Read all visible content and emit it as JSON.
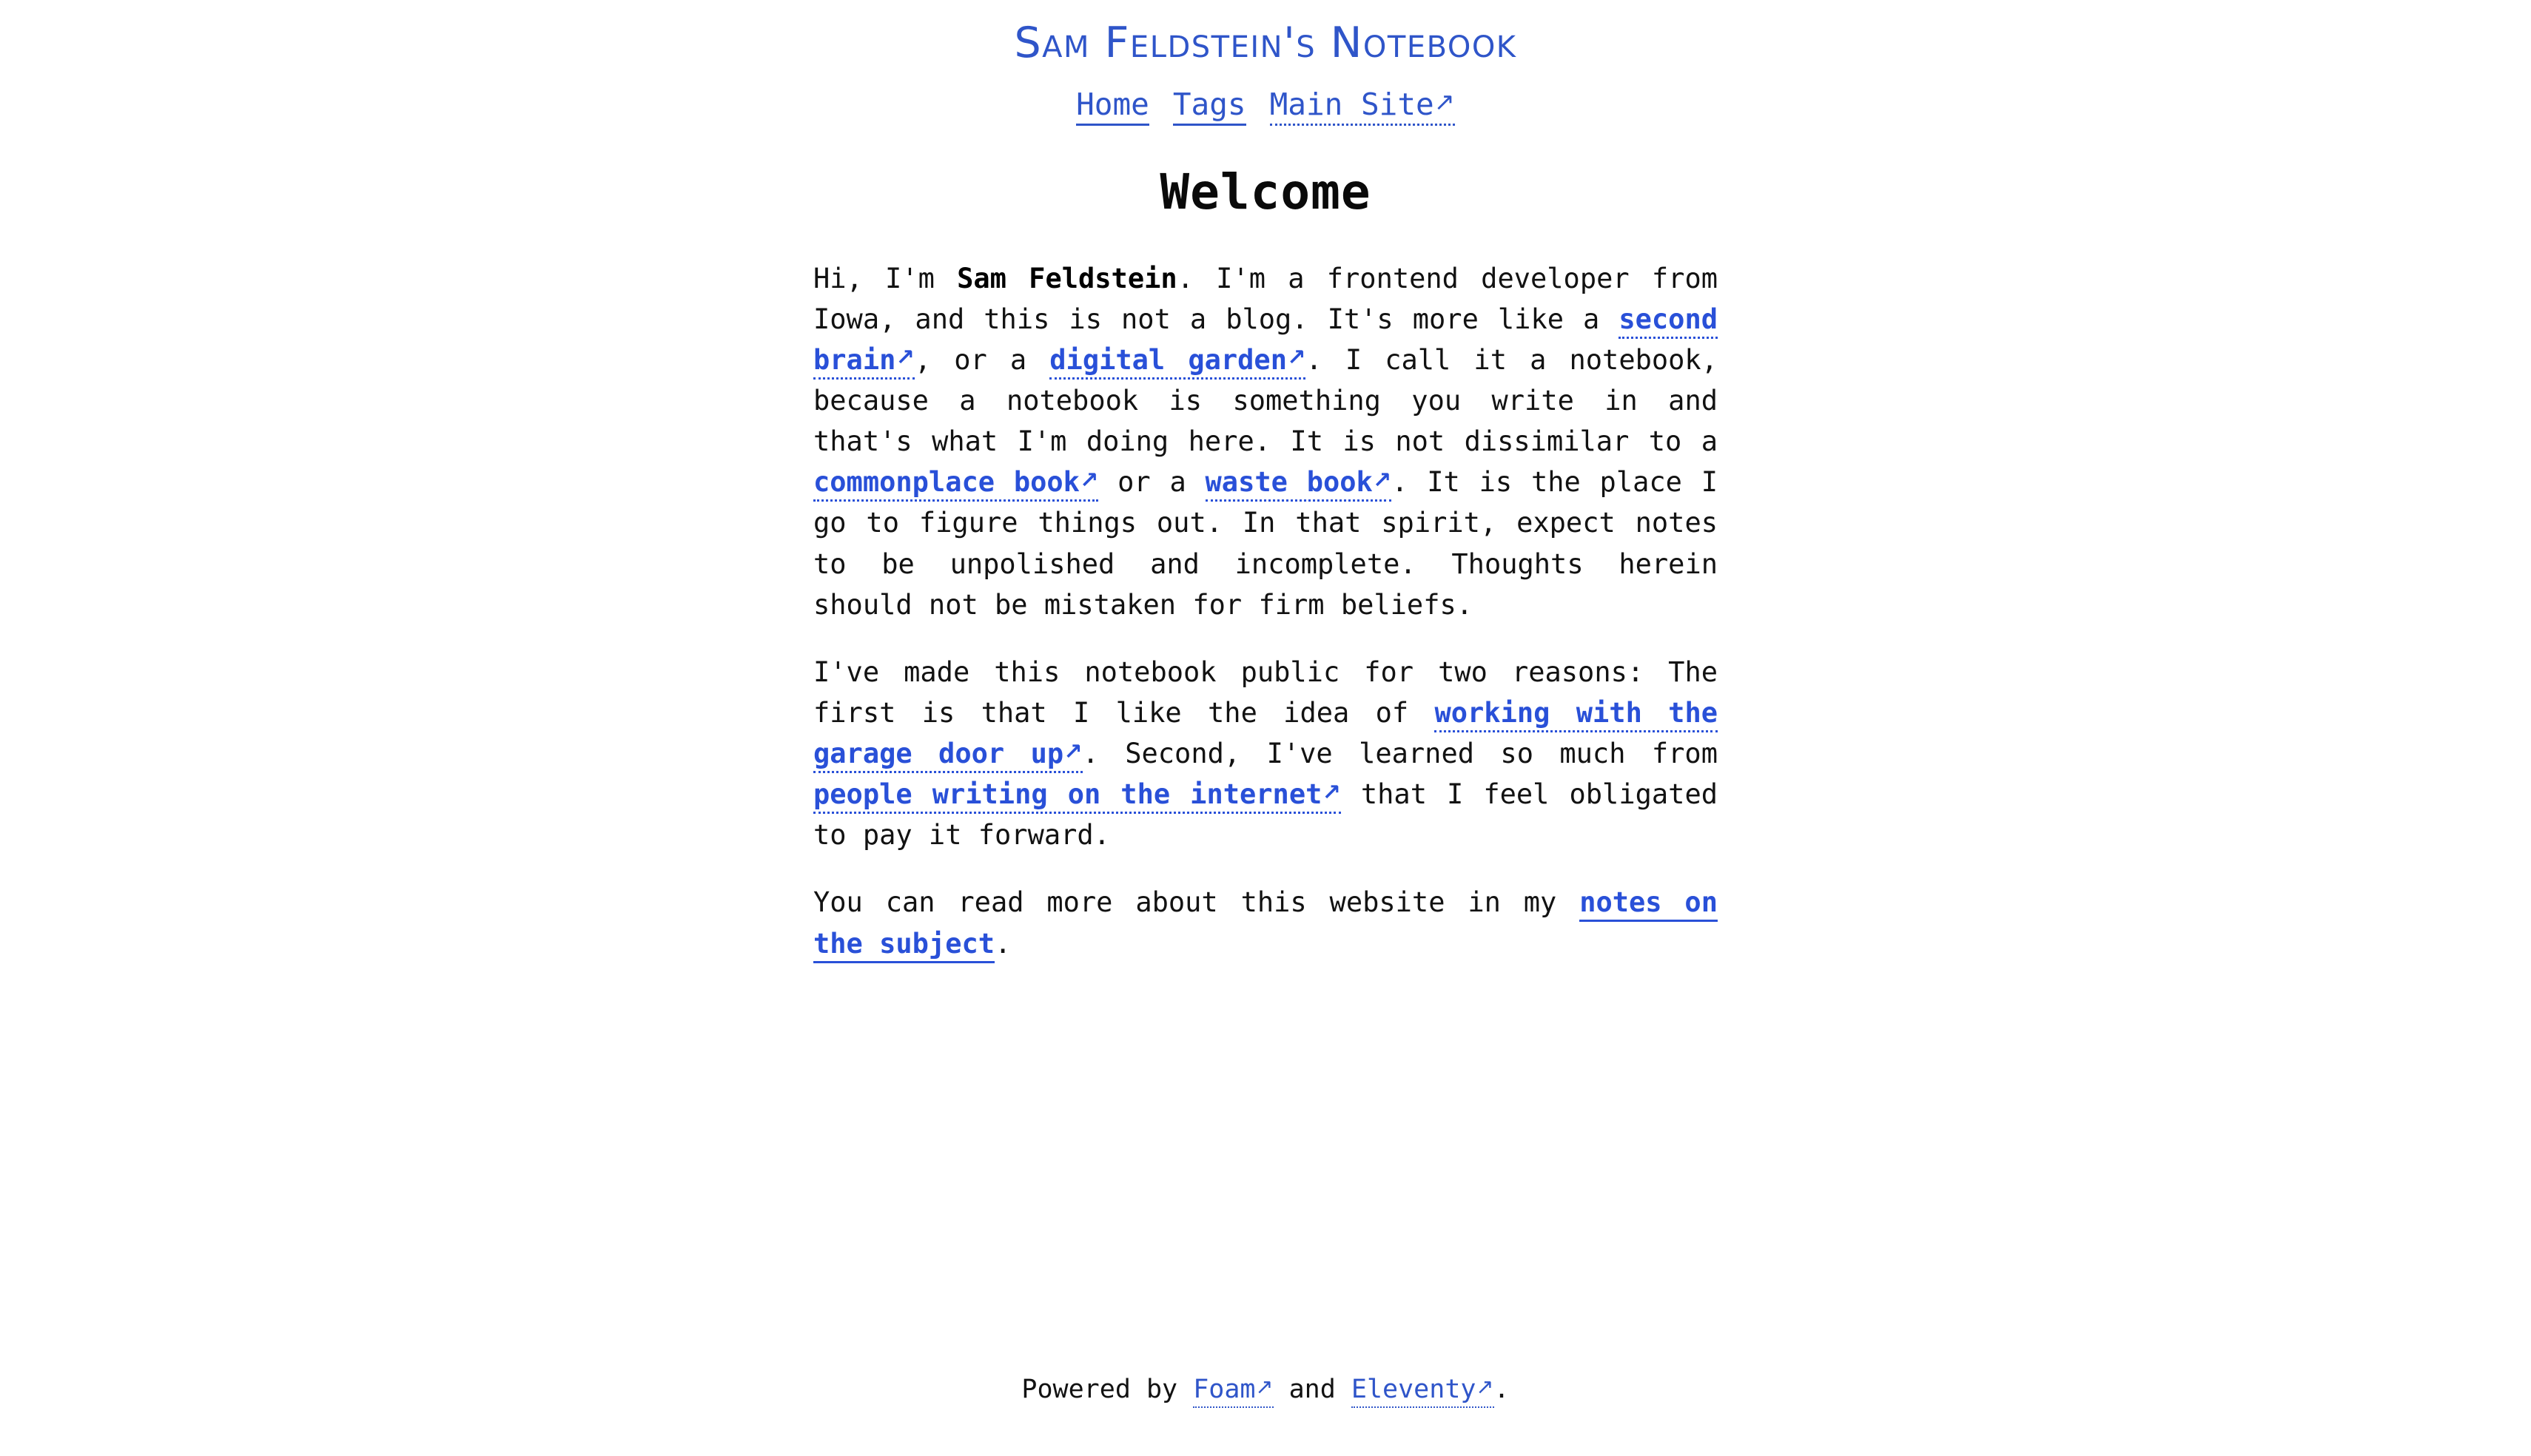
{
  "site": {
    "title": "Sam Feldstein's Notebook",
    "accent_color": "#2f55c9",
    "link_color": "#2950d8",
    "text_color": "#121212",
    "background_color": "#ffffff"
  },
  "nav": {
    "items": [
      {
        "label": "Home",
        "external": false
      },
      {
        "label": "Tags",
        "external": false
      },
      {
        "label": "Main Site",
        "external": true
      }
    ]
  },
  "main": {
    "heading": "Welcome",
    "paragraph1": {
      "seg1": "Hi, I'm ",
      "name": "Sam Feldstein",
      "seg2": ". I'm a frontend developer from Iowa, and this is not a blog. It's more like a ",
      "link1": "second brain",
      "seg3": ", or a ",
      "link2": "digital garden",
      "seg4": ". I call it a notebook, because a notebook is something you write in and that's what I'm doing here. It is not dissimilar to a ",
      "link3": "commonplace book",
      "seg5": " or a ",
      "link4": "waste book",
      "seg6": ". It is the place I go to figure things out. In that spirit, expect notes to be unpolished and incomplete. Thoughts herein should not be mistaken for firm beliefs."
    },
    "paragraph2": {
      "seg1": "I've made this notebook public for two reasons: The first is that I like the idea of ",
      "link1": "working with the garage door up",
      "seg2": ". Second, I've learned so much from ",
      "link2": "people writing on the internet",
      "seg3": " that I feel obligated to pay it forward."
    },
    "paragraph3": {
      "seg1": "You can read more about this website in my ",
      "link1": "notes on the subject",
      "seg2": "."
    }
  },
  "footer": {
    "prefix": "Powered by ",
    "link1": "Foam",
    "middle": " and ",
    "link2": "Eleventy",
    "suffix": "."
  },
  "icons": {
    "external_arrow": "↗"
  }
}
